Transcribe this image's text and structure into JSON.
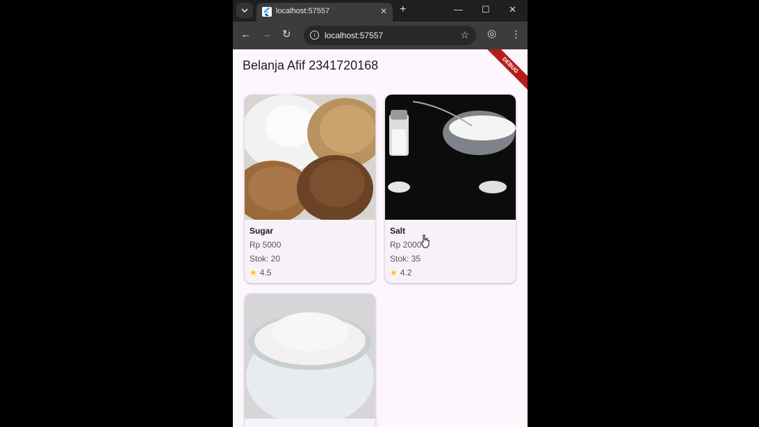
{
  "browser": {
    "tab_title": "localhost:57557",
    "tab_close": "✕",
    "new_tab": "+",
    "minimize": "—",
    "maximize": "☐",
    "close": "✕",
    "url": "localhost:57557",
    "back": "←",
    "forward": "→",
    "reload": "↻",
    "star": "☆",
    "profile": "◎",
    "menu": "⋮"
  },
  "app": {
    "title": "Belanja Afif 2341720168",
    "debug_banner": "DEBUG"
  },
  "products": [
    {
      "name": "Sugar",
      "price": "Rp 5000",
      "stock": "Stok: 20",
      "rating": "4.5"
    },
    {
      "name": "Salt",
      "price": "Rp 2000",
      "stock": "Stok: 35",
      "rating": "4.2"
    }
  ],
  "icons": {
    "star": "★"
  },
  "colors": {
    "page_bg": "#fdf7fd",
    "card_bg": "#f7f2fa",
    "star": "#ffc107",
    "debug_banner": "#b71c1c"
  }
}
